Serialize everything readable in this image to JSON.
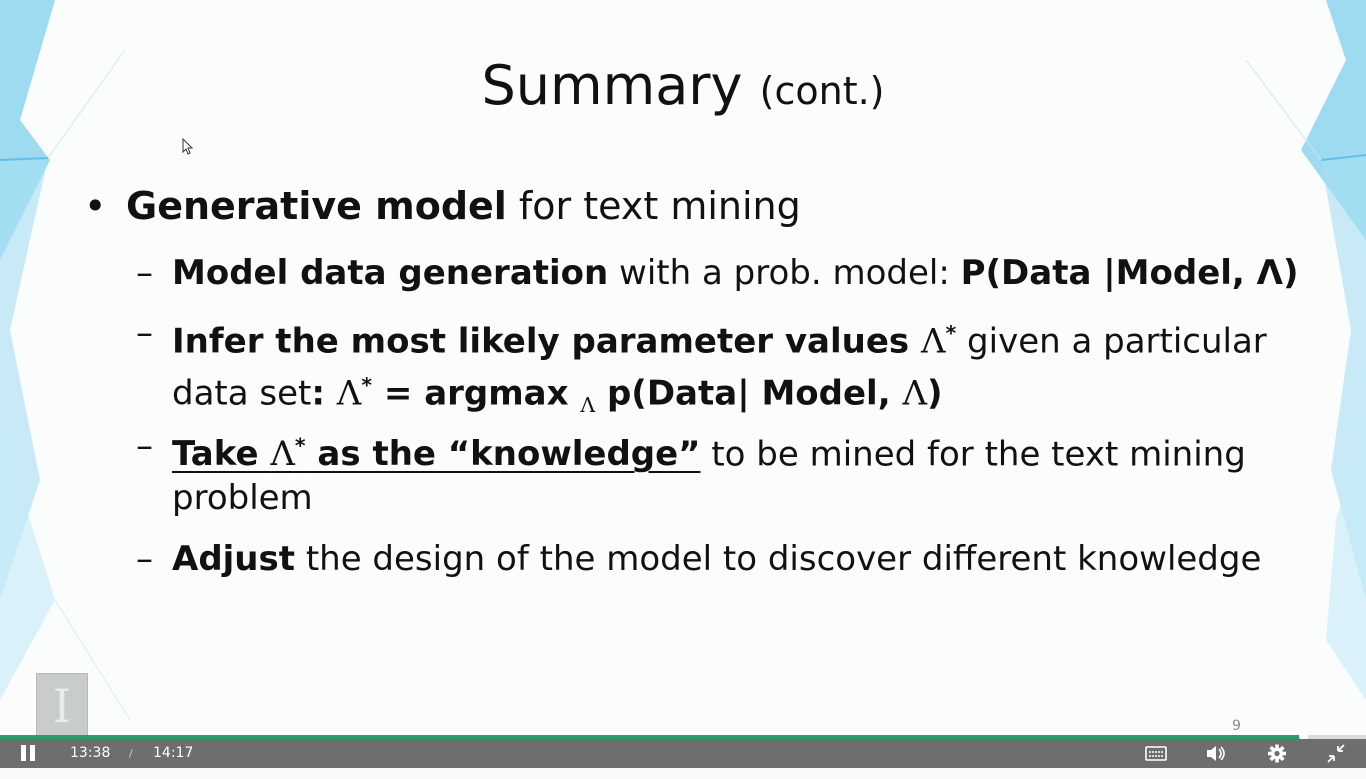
{
  "slide": {
    "title": "Summary",
    "title_suffix": "(cont.)",
    "bullet_symbol": "•",
    "bullet": {
      "bold": "Generative model",
      "rest": " for text mining"
    },
    "dash_symbol": "–",
    "items": [
      {
        "bold": "Model data generation",
        "rest": " with a prob. model:  ",
        "formula": "P(Data |Model, Λ)"
      },
      {
        "bold_prefix": "Infer the most likely parameter values ",
        "line1_lambda": "Λ",
        "line1_star": "*",
        "line1_rest": " given a particular",
        "line2_prefix": "data set",
        "line2_colon": ":  ",
        "line2_lambda": "Λ",
        "line2_star": "*",
        "line2_argmax": " = argmax ",
        "line2_sub": "Λ",
        "line2_p": " p(Data| Model, ",
        "line2_lambda_end": "Λ",
        "line2_close": ")"
      },
      {
        "u_prefix": "Take ",
        "u_lambda": "Λ",
        "u_star": "*",
        "u_rest": " as the “knowledge”",
        "rest": " to be mined for the text mining",
        "line2": "problem"
      },
      {
        "bold": "Adjust",
        "rest": " the design of the model to discover different knowledge"
      }
    ],
    "page_number": "9",
    "logo_letter": "I"
  },
  "player": {
    "current_time": "13:38",
    "separator": "/",
    "duration": "14:17",
    "progress_fraction": 0.954,
    "icons": {
      "play_pause": "pause-icon",
      "captions": "captions-icon",
      "volume": "volume-icon",
      "settings": "gear-icon",
      "exit_fullscreen": "exit-fullscreen-icon"
    },
    "colors": {
      "progress": "#1fa36b",
      "bar": "#6e6e6e"
    }
  }
}
